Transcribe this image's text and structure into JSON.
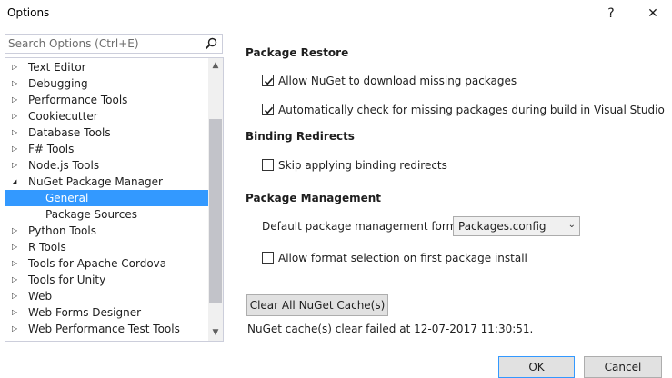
{
  "window": {
    "title": "Options",
    "help_glyph": "?",
    "close_glyph": "✕"
  },
  "search": {
    "placeholder": "Search Options (Ctrl+E)",
    "icon": "search-icon"
  },
  "tree": {
    "items": [
      {
        "label": "Text Editor",
        "expanded": false,
        "level": 0
      },
      {
        "label": "Debugging",
        "expanded": false,
        "level": 0
      },
      {
        "label": "Performance Tools",
        "expanded": false,
        "level": 0
      },
      {
        "label": "Cookiecutter",
        "expanded": false,
        "level": 0
      },
      {
        "label": "Database Tools",
        "expanded": false,
        "level": 0
      },
      {
        "label": "F# Tools",
        "expanded": false,
        "level": 0
      },
      {
        "label": "Node.js Tools",
        "expanded": false,
        "level": 0
      },
      {
        "label": "NuGet Package Manager",
        "expanded": true,
        "level": 0
      },
      {
        "label": "General",
        "level": 1,
        "selected": true
      },
      {
        "label": "Package Sources",
        "level": 1
      },
      {
        "label": "Python Tools",
        "expanded": false,
        "level": 0
      },
      {
        "label": "R Tools",
        "expanded": false,
        "level": 0
      },
      {
        "label": "Tools for Apache Cordova",
        "expanded": false,
        "level": 0
      },
      {
        "label": "Tools for Unity",
        "expanded": false,
        "level": 0
      },
      {
        "label": "Web",
        "expanded": false,
        "level": 0
      },
      {
        "label": "Web Forms Designer",
        "expanded": false,
        "level": 0
      },
      {
        "label": "Web Performance Test Tools",
        "expanded": false,
        "level": 0
      }
    ]
  },
  "package_restore": {
    "heading": "Package Restore",
    "allow_download": {
      "label": "Allow NuGet to download missing packages",
      "checked": true
    },
    "auto_check": {
      "label": "Automatically check for missing packages during build in Visual Studio",
      "checked": true
    }
  },
  "binding_redirects": {
    "heading": "Binding Redirects",
    "skip": {
      "label": "Skip applying binding redirects",
      "checked": false
    }
  },
  "package_management": {
    "heading": "Package Management",
    "format_label": "Default package management format:",
    "format_value": "Packages.config",
    "allow_format": {
      "label": "Allow format selection on first package install",
      "checked": false
    }
  },
  "cache": {
    "button_label": "Clear All NuGet Cache(s)",
    "status": "NuGet cache(s) clear failed at 12-07-2017 11:30:51."
  },
  "footer": {
    "ok_label": "OK",
    "cancel_label": "Cancel"
  },
  "colors": {
    "selection": "#3399ff",
    "border": "#cccedb"
  }
}
